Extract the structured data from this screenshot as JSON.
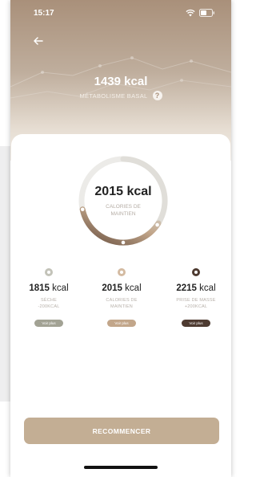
{
  "status_bar": {
    "time": "15:17"
  },
  "header": {
    "bmr_value": "1439 kcal",
    "bmr_label": "MÉTABOLISME BASAL",
    "help": "?"
  },
  "maintenance": {
    "value": "2015 kcal",
    "label_line1": "CALORIES DE",
    "label_line2": "MAINTIEN"
  },
  "options": [
    {
      "value": "1815",
      "unit": "kcal",
      "desc_line1": "SÈCHE",
      "desc_line2": "-200KCAL",
      "button": "Voir plus",
      "selected": false
    },
    {
      "value": "2015",
      "unit": "kcal",
      "desc_line1": "CALORIES DE",
      "desc_line2": "MAINTIEN",
      "button": "Voir plus",
      "selected": false
    },
    {
      "value": "2215",
      "unit": "kcal",
      "desc_line1": "PRISE DE MASSE",
      "desc_line2": "+200KCAL",
      "button": "Voir plus",
      "selected": true
    }
  ],
  "restart_button": "RECOMMENCER",
  "colors": {
    "option_1": "#a2a294",
    "option_2": "#c2a68a",
    "option_3": "#4e3b31",
    "accent": "#c3ae94"
  }
}
